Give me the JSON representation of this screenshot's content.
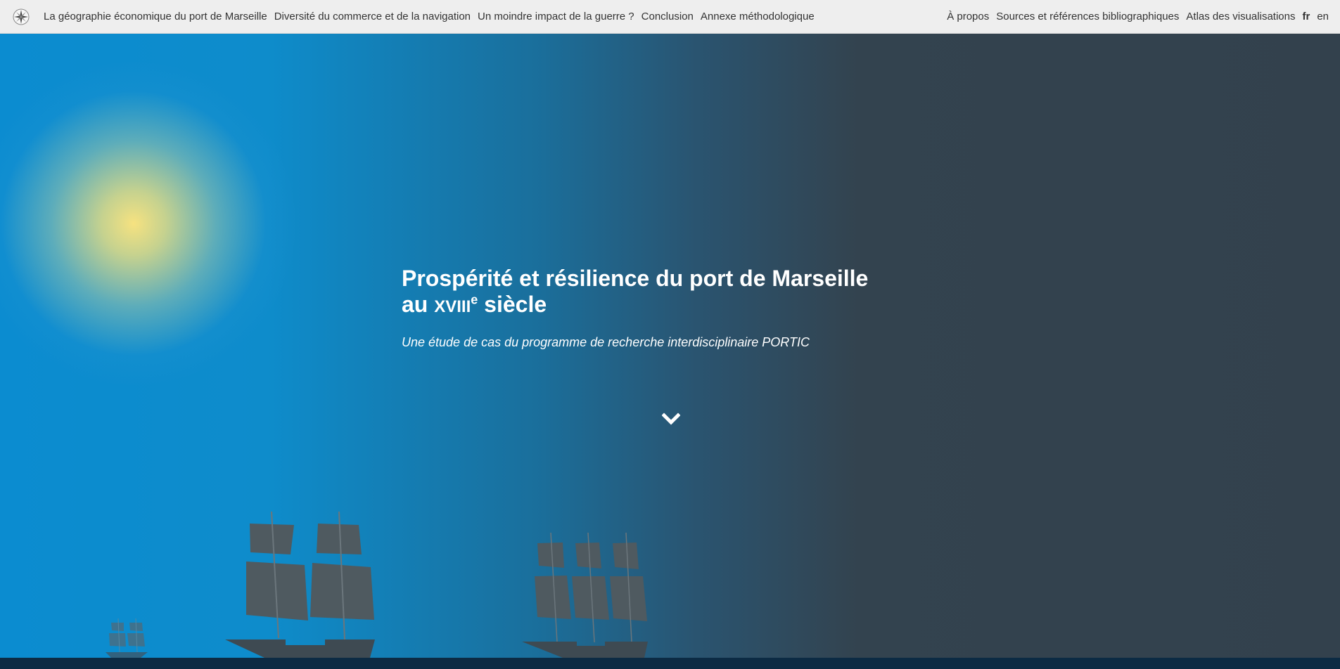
{
  "nav": {
    "logo_icon": "compass-rose-icon",
    "left_items": [
      {
        "label": "La géographie économique du port de Marseille"
      },
      {
        "label": "Diversité du commerce et de la navigation"
      },
      {
        "label": "Un moindre impact de la guerre ?"
      },
      {
        "label": "Conclusion"
      },
      {
        "label": "Annexe méthodologique"
      }
    ],
    "right_items": [
      {
        "label": "À propos"
      },
      {
        "label": "Sources et références bibliographiques"
      },
      {
        "label": "Atlas des visualisations"
      }
    ],
    "languages": [
      {
        "label": "fr",
        "active": true
      },
      {
        "label": "en",
        "active": false
      }
    ]
  },
  "hero": {
    "title_line1": "Prospérité et résilience du port de Marseille",
    "title_line2_prefix": "au ",
    "title_century": "XVIII",
    "title_sup": "e",
    "title_line2_suffix": " siècle",
    "subtitle": "Une étude de cas du programme de recherche interdisciplinaire PORTIC",
    "scroll_icon": "chevron-down-icon"
  },
  "colors": {
    "nav_bg": "#eeeeee",
    "sky_blue": "#0b8cd0",
    "dusk_gray": "#33414d",
    "sun": "#f6e280",
    "ship": "#3e4a52",
    "sail": "#4f5a60",
    "bottom_bar": "#0c2b44"
  }
}
